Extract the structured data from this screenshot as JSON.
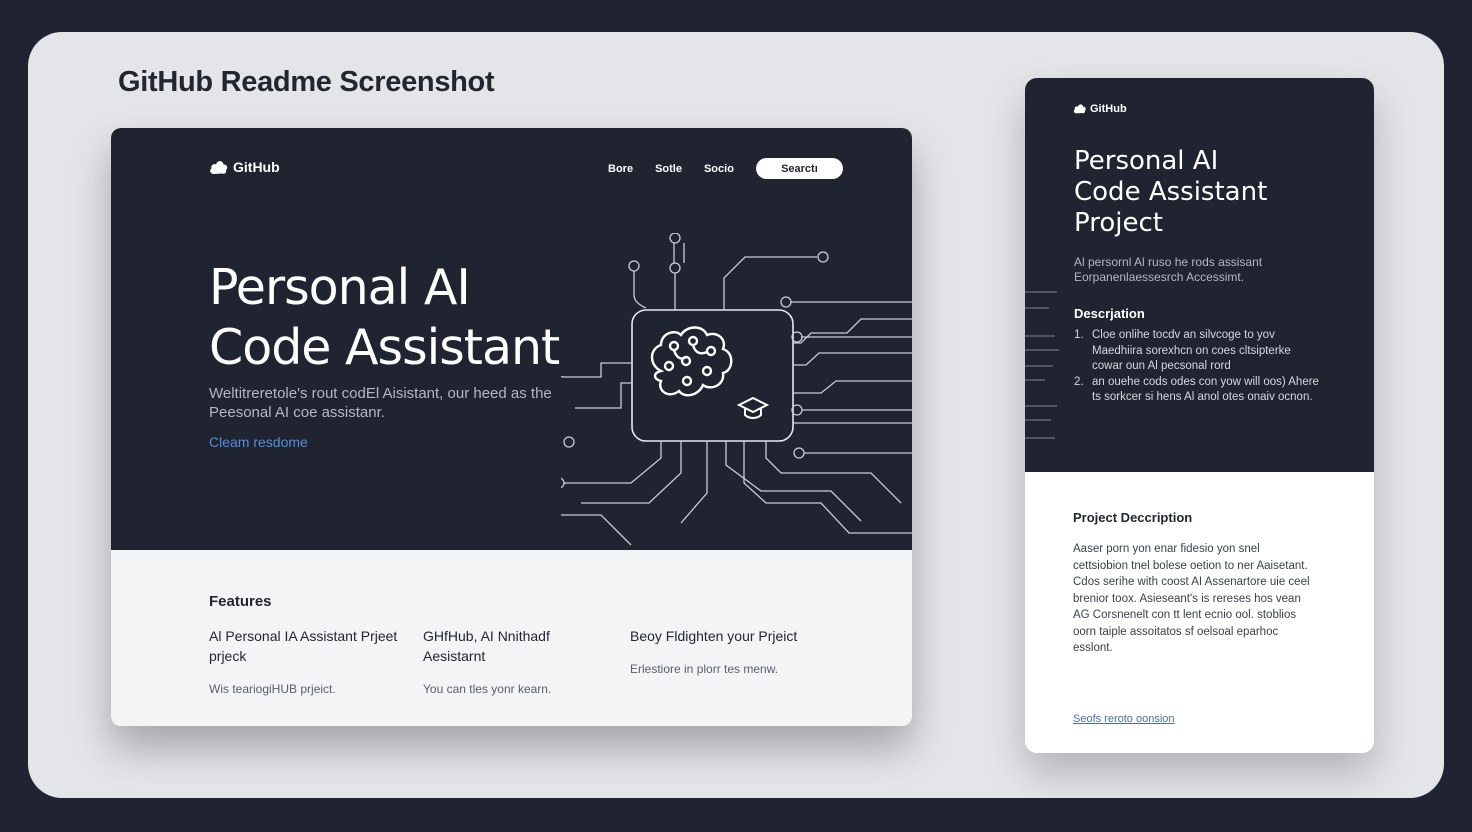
{
  "page": {
    "title": "GitHub Readme Screenshot"
  },
  "desktop": {
    "logo_text": "GitHub",
    "nav": [
      "Bore",
      "Sotle",
      "Socio"
    ],
    "search_label": "Searctı",
    "hero": {
      "title_line1": "Personal AI",
      "title_line2": "Code Assistant",
      "subtitle": "Weltitreretole's rout codEl Aisistant, our heed as the Peesonal AI coe assistanr.",
      "link": "Cleam resdome"
    },
    "features": {
      "heading": "Features",
      "items": [
        {
          "title": "Al Personal IA Assistant Prjeet prjeck",
          "desc": "Wis teariogiHUB prjeict."
        },
        {
          "title": "GHfHub, AI Nnithadf Aesistarnt",
          "desc": "You can tles yonr kearn."
        },
        {
          "title": "Beoy Fldighten your Prjeict",
          "desc": "Erlestiore in plorr tes menw."
        }
      ]
    }
  },
  "mobile": {
    "logo_text": "GitHub",
    "title_line1": "Personal AI",
    "title_line2": "Code Assistant",
    "title_line3": "Project",
    "intro": "Al persornl Al ruso he rods assisant Eorpanenlaessesrch Accessimt.",
    "description_heading": "Descrjation",
    "list": [
      {
        "num": "1.",
        "text": "Cloe onlihe tocdv an silvcoge to yov Maedhiira sorexhcn on coes cltsipterke cowar oun Al pecsonal rord"
      },
      {
        "num": "2.",
        "text": "an ouehe cods odes con yow will oos) Ahere ts sorkcer si hens Al anol otes onaiv ocnon."
      }
    ],
    "project_description_heading": "Project Deccription",
    "project_description_body": "Aaser porn yon enar fidesio yon snel cettsiobion tnel bolese oetion to ner Aaisetant. Cdos serihe with coost AI Assenartore uie ceel brenior toox. Asieseant's is rereses hos vean AG Corsnenelt con tt lent ecnio ool. stoblios oorn taiple assoitatos sf oelsoal eparhoc esslont.",
    "link": "Seofs reroto oonsion"
  }
}
